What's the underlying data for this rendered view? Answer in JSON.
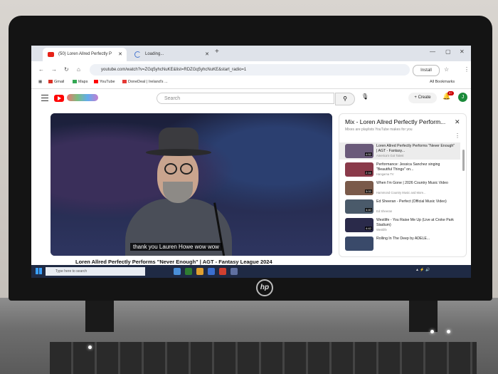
{
  "browser": {
    "tabs": [
      {
        "label": "(50) Loren Allred Perfectly P",
        "favicon": "youtube-icon",
        "active": true
      },
      {
        "label": "Loading...",
        "favicon": "spinner-icon",
        "active": false
      }
    ],
    "url": "youtube.com/watch?v=ZGq5yhcNuKE&list=RDZGq5yhcNuKE&start_radio=1",
    "install_label": "Install",
    "bookmarks": [
      {
        "label": "Gmail",
        "color": "#d93025"
      },
      {
        "label": "Maps",
        "color": "#34a853"
      },
      {
        "label": "YouTube",
        "color": "#ff0000"
      },
      {
        "label": "DoneDeal | Ireland's ...",
        "color": "#e53935"
      }
    ],
    "all_bookmarks_label": "All Bookmarks"
  },
  "youtube": {
    "search_placeholder": "Search",
    "create_label": "Create",
    "notification_count": "9+",
    "avatar_letter": "J",
    "video": {
      "caption": "thank you Lauren Howe wow wow",
      "title": "Loren Allred Perfectly Performs \"Never Enough\" | AGT - Fantasy League 2024"
    },
    "playlist": {
      "title": "Mix - Loren Allred Perfectly Perform...",
      "subtitle": "Mixes are playlists YouTube makes for you",
      "items": [
        {
          "title": "Loren Allred Perfectly Performs \"Never Enough\" | AGT - Fantasy...",
          "channel": "America's Got Talent",
          "duration": "4:52",
          "thumb": "#6a5a7a",
          "selected": true
        },
        {
          "title": "Performance: Jessica Sanchez singing \"Beautiful Things\" on...",
          "channel": "Hangama TV",
          "duration": "2:16",
          "thumb": "#8a3a4a",
          "selected": false
        },
        {
          "title": "When I'm Gone | 2026 Country Music Video",
          "channel": "Hammond Country Music and More...",
          "duration": "3:02",
          "thumb": "#7a5a4a",
          "selected": false
        },
        {
          "title": "Ed Sheeran - Perfect (Official Music Video)",
          "channel": "Ed Sheeran",
          "duration": "4:40",
          "thumb": "#4a5a6a",
          "selected": false
        },
        {
          "title": "Westlife - You Raise Me Up (Live at Croke Park Stadium)",
          "channel": "Westlife",
          "duration": "4:42",
          "thumb": "#2a2a4a",
          "selected": false
        },
        {
          "title": "Rolling In The Deep by ADELE...",
          "channel": "",
          "duration": "",
          "thumb": "#3a4a6a",
          "selected": false
        }
      ]
    }
  },
  "taskbar": {
    "search_placeholder": "Type here to search"
  },
  "laptop": {
    "brand": "hp"
  }
}
